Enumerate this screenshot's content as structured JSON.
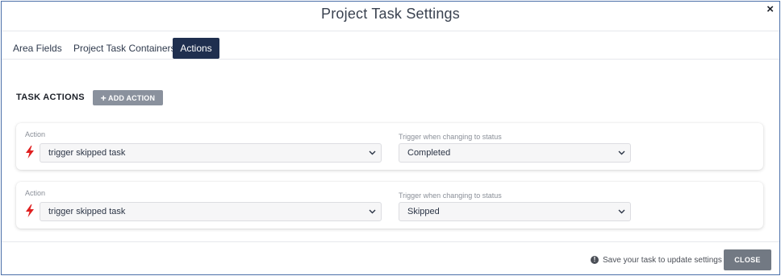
{
  "modal": {
    "title": "Project Task Settings",
    "close_icon": "×"
  },
  "tabs": [
    {
      "label": "Area Fields",
      "active": false
    },
    {
      "label": "Project Task Containers",
      "active": false
    },
    {
      "label": "Actions",
      "active": true
    }
  ],
  "section": {
    "title": "TASK ACTIONS",
    "add_button_label": "ADD ACTION",
    "add_button_icon": "+"
  },
  "actions": [
    {
      "action_label": "Action",
      "action_value": "trigger skipped task",
      "trigger_label": "Trigger when changing to status",
      "trigger_value": "Completed",
      "icon": "lightning-bolt-icon"
    },
    {
      "action_label": "Action",
      "action_value": "trigger skipped task",
      "trigger_label": "Trigger when changing to status",
      "trigger_value": "Skipped",
      "icon": "lightning-bolt-icon"
    }
  ],
  "footer": {
    "info_icon": "!",
    "note": "Save your task to update settings",
    "close_label": "CLOSE"
  },
  "colors": {
    "active_tab_bg": "#1f2f4f",
    "bolt": "#e02020",
    "add_button_bg": "#8a919d",
    "close_button_bg": "#727983"
  }
}
